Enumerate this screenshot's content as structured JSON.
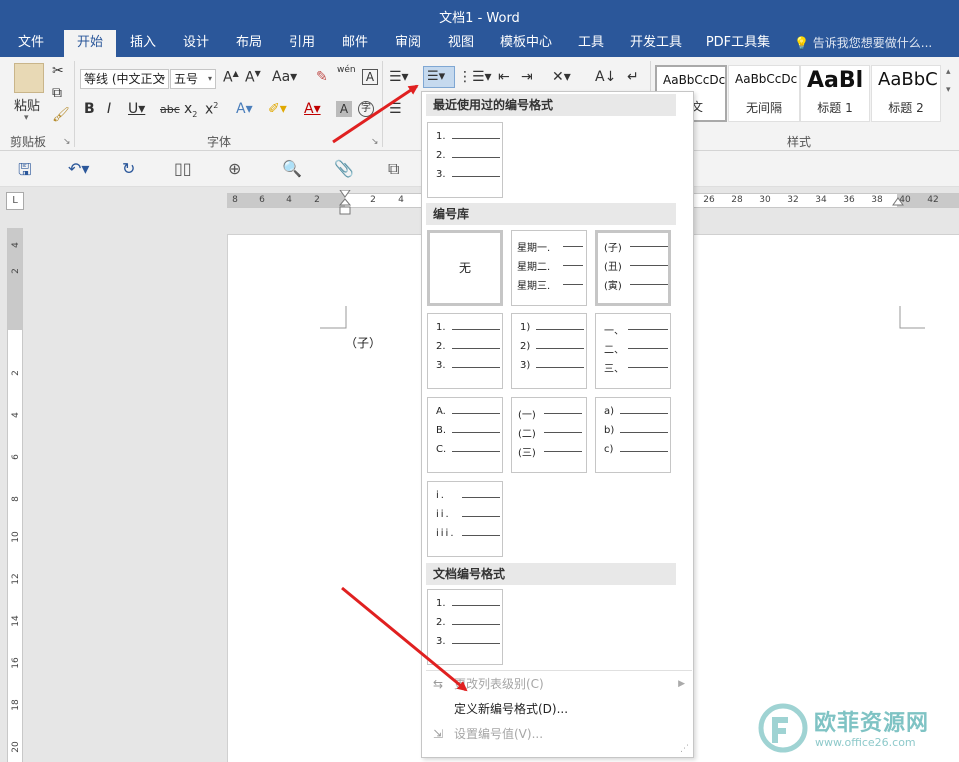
{
  "window": {
    "title": "文档1 - Word"
  },
  "tabs": [
    {
      "label": "文件"
    },
    {
      "label": "开始"
    },
    {
      "label": "插入"
    },
    {
      "label": "设计"
    },
    {
      "label": "布局"
    },
    {
      "label": "引用"
    },
    {
      "label": "邮件"
    },
    {
      "label": "审阅"
    },
    {
      "label": "视图"
    },
    {
      "label": "模板中心"
    },
    {
      "label": "工具"
    },
    {
      "label": "开发工具"
    },
    {
      "label": "PDF工具集"
    }
  ],
  "active_tab": "开始",
  "tell_me": {
    "placeholder": "告诉我您想要做什么..."
  },
  "ribbon": {
    "clipboard": {
      "paste_label": "粘贴",
      "group_label": "剪贴板"
    },
    "font": {
      "font_name": "等线 (中文正文",
      "font_size": "五号",
      "group_label": "字体",
      "pinyin_label": "wén"
    },
    "styles": {
      "group_label": "样式",
      "tiles": [
        {
          "preview": "AaBbCcDc",
          "name": "正文"
        },
        {
          "preview": "AaBbCcDc",
          "name": "无间隔"
        },
        {
          "preview": "AaBl",
          "name": "标题 1"
        },
        {
          "preview": "AaBbC",
          "name": "标题 2"
        }
      ]
    }
  },
  "ruler": {
    "corner": "L",
    "h_numbers": [
      "8",
      "6",
      "4",
      "2",
      "2",
      "4",
      "26",
      "28",
      "30",
      "32",
      "34",
      "36",
      "38",
      "40",
      "42"
    ],
    "v_numbers": [
      "4",
      "2",
      "2",
      "2",
      "4",
      "6",
      "8",
      "10",
      "12",
      "14",
      "16",
      "18",
      "20"
    ]
  },
  "document": {
    "text": "（子）"
  },
  "numbering_menu": {
    "recent_header": "最近使用过的编号格式",
    "recent": [
      [
        "1.",
        "2.",
        "3."
      ]
    ],
    "library_header": "编号库",
    "library": [
      {
        "none": "无"
      },
      {
        "items": [
          "星期一.",
          "星期二.",
          "星期三."
        ]
      },
      {
        "items": [
          "(子)",
          "(丑)",
          "(寅)"
        ]
      },
      {
        "items": [
          "1.",
          "2.",
          "3."
        ]
      },
      {
        "items": [
          "1)",
          "2)",
          "3)"
        ]
      },
      {
        "items": [
          "一、",
          "二、",
          "三、"
        ]
      },
      {
        "items": [
          "A.",
          "B.",
          "C."
        ]
      },
      {
        "items": [
          "(一)",
          "(二)",
          "(三)"
        ]
      },
      {
        "items": [
          "a)",
          "b)",
          "c)"
        ]
      },
      {
        "items": [
          "i.",
          "ii.",
          "iii."
        ]
      }
    ],
    "document_header": "文档编号格式",
    "document": [
      [
        "1.",
        "2.",
        "3."
      ]
    ],
    "menu_items": [
      {
        "label": "更改列表级别(C)",
        "enabled": false
      },
      {
        "label": "定义新编号格式(D)...",
        "enabled": true
      },
      {
        "label": "设置编号值(V)...",
        "enabled": false
      }
    ]
  },
  "watermark": {
    "title": "欧菲资源网",
    "url": "www.office26.com"
  },
  "colors": {
    "title_bar": "#2b579a",
    "ribbon": "#f3f3f3",
    "arrow": "#e02020",
    "watermark": "#7fc3c4"
  }
}
